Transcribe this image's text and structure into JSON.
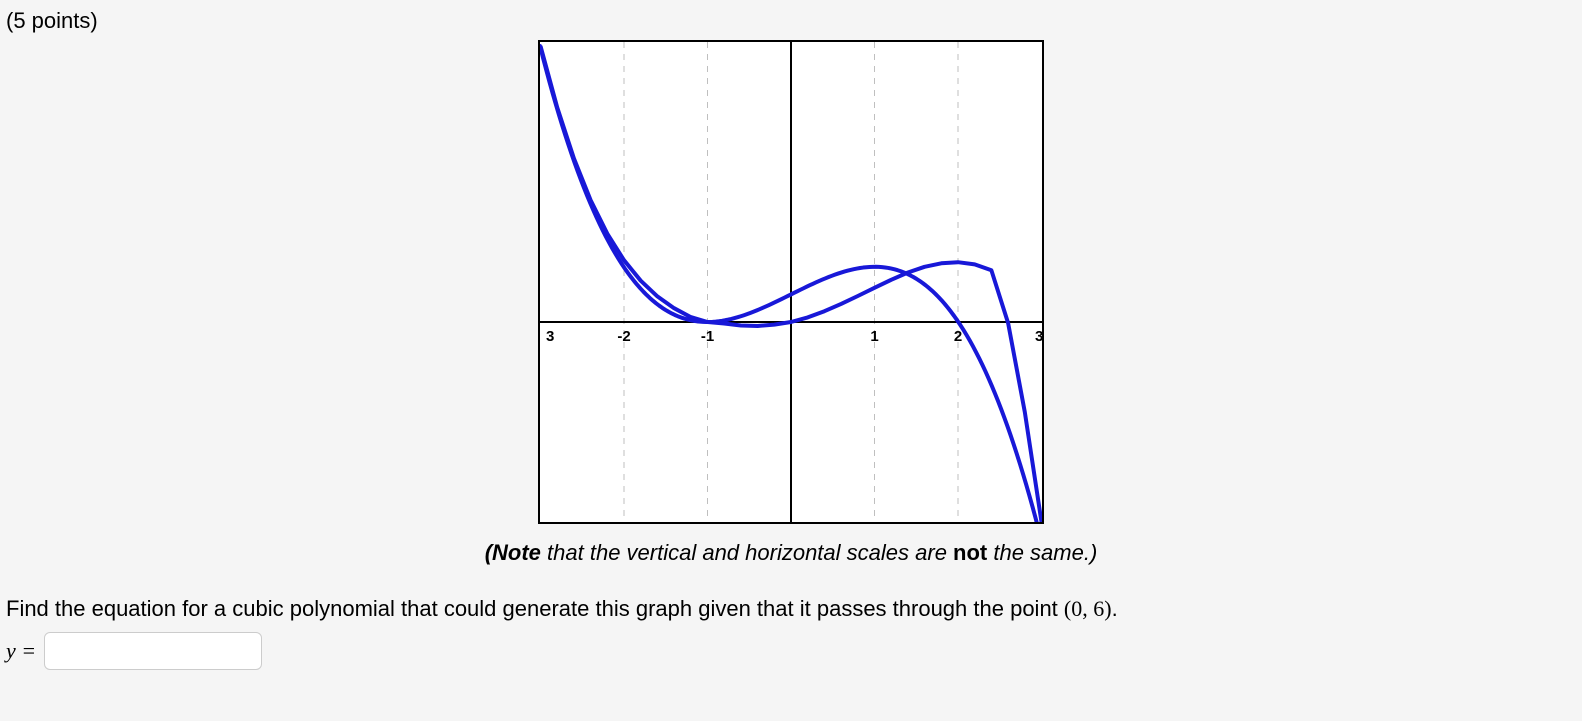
{
  "points_label": "(5 points)",
  "note": {
    "prefix_bold": "(Note",
    "middle": " that the vertical and horizontal scales are ",
    "not": "not",
    "suffix": " the same.)"
  },
  "question": {
    "text_before": "Find the equation for a cubic polynomial that could generate this graph given that it passes through the point ",
    "point": "(0, 6)",
    "text_after": "."
  },
  "answer": {
    "label": "y =",
    "value": ""
  },
  "chart_data": {
    "type": "line",
    "xrange": [
      -3,
      3
    ],
    "x_ticks": [
      -3,
      -2,
      -1,
      1,
      2,
      3
    ],
    "x_tick_labels": [
      "3",
      "-2",
      "-1",
      "1",
      "2",
      "3"
    ],
    "grid": true,
    "axes": {
      "x0": 0,
      "y0": 0
    },
    "roots": [
      -1,
      -1,
      2
    ],
    "passes_through": {
      "x": 0,
      "y": 6
    },
    "leading_sign": "negative",
    "x": [
      -3,
      -2.8,
      -2.6,
      -2.4,
      -2.2,
      -2,
      -1.8,
      -1.6,
      -1.4,
      -1.2,
      -1,
      -0.8,
      -0.6,
      -0.4,
      -0.2,
      0,
      0.2,
      0.4,
      0.6,
      0.8,
      1,
      1.2,
      1.4,
      1.6,
      1.8,
      2,
      2.2,
      2.4,
      2.6,
      2.8,
      3
    ],
    "y": [
      60,
      46.656,
      35.568,
      26.496,
      19.2,
      13.44,
      8.976,
      5.568,
      3,
      1.056,
      0,
      -0.336,
      -0.768,
      -0.864,
      -0.576,
      0,
      1.008,
      2.352,
      3.936,
      5.664,
      7.44,
      9.168,
      10.752,
      12,
      12.768,
      13,
      12.528,
      11.232,
      8.976,
      5.624,
      1.04
    ]
  }
}
